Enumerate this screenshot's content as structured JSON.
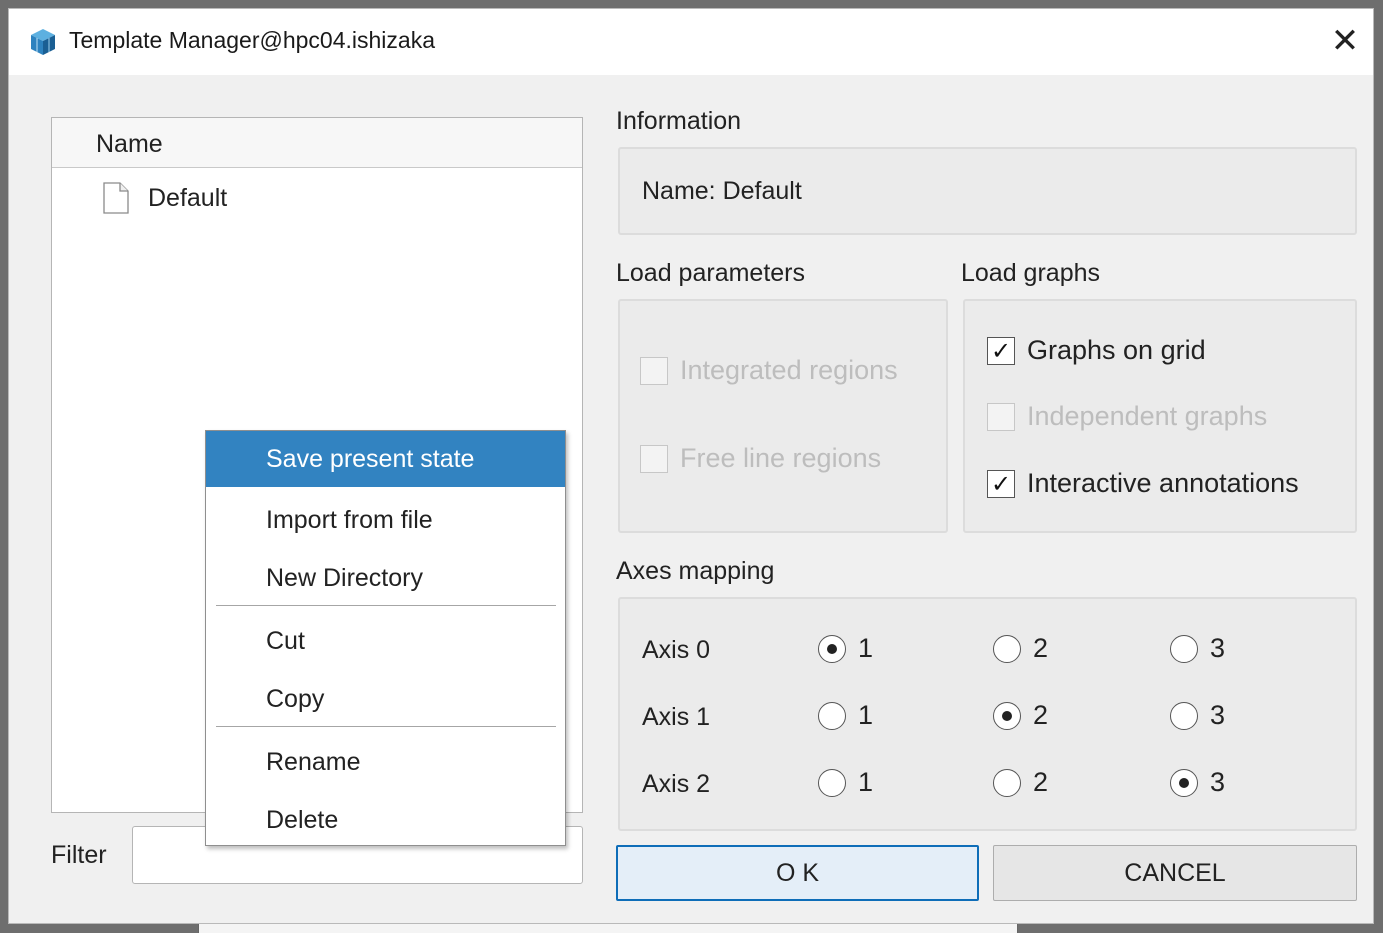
{
  "window": {
    "title": "Template Manager@hpc04.ishizaka",
    "close_symbol": "✕"
  },
  "tree": {
    "column_header": "Name",
    "items": [
      {
        "label": "Default",
        "icon": "file-icon"
      }
    ]
  },
  "filter": {
    "label": "Filter",
    "value": ""
  },
  "information": {
    "label": "Information",
    "text": "Name: Default"
  },
  "load_parameters": {
    "label": "Load parameters",
    "options": [
      {
        "label": "Integrated regions",
        "checked": false,
        "enabled": false
      },
      {
        "label": "Free line regions",
        "checked": false,
        "enabled": false
      }
    ]
  },
  "load_graphs": {
    "label": "Load graphs",
    "options": [
      {
        "label": "Graphs on grid",
        "checked": true,
        "enabled": true
      },
      {
        "label": "Independent graphs",
        "checked": false,
        "enabled": false
      },
      {
        "label": "Interactive annotations",
        "checked": true,
        "enabled": true
      }
    ],
    "check_mark": "✓"
  },
  "axes_mapping": {
    "label": "Axes mapping",
    "rows": [
      {
        "label": "Axis 0",
        "choices": [
          "1",
          "2",
          "3"
        ],
        "selected": "1"
      },
      {
        "label": "Axis 1",
        "choices": [
          "1",
          "2",
          "3"
        ],
        "selected": "2"
      },
      {
        "label": "Axis 2",
        "choices": [
          "1",
          "2",
          "3"
        ],
        "selected": "3"
      }
    ]
  },
  "buttons": {
    "ok": "O K",
    "cancel": "CANCEL"
  },
  "context_menu": {
    "items": [
      {
        "label": "Save present state",
        "highlighted": true
      },
      {
        "label": "Import from file"
      },
      {
        "label": "New Directory"
      },
      {
        "label": "Cut"
      },
      {
        "label": "Copy"
      },
      {
        "label": "Rename"
      },
      {
        "label": "Delete"
      }
    ]
  },
  "colors": {
    "accent": "#3283c1",
    "ok_border": "#0e6db8",
    "window_bg": "#f0f0f0"
  }
}
